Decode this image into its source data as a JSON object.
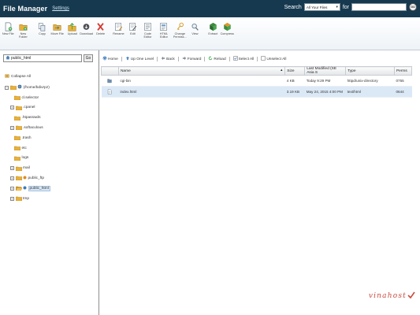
{
  "header": {
    "title": "File Manager",
    "settings_label": "Settings",
    "search_label": "Search",
    "search_scope": "All Your Files",
    "for_label": "for",
    "search_value": "",
    "go_label": "GO"
  },
  "toolbar": {
    "buttons": [
      {
        "label": "New File",
        "icon": "new-file-icon"
      },
      {
        "label": "New\nFolder",
        "icon": "new-folder-icon"
      },
      {
        "label": "Copy",
        "icon": "copy-icon"
      },
      {
        "label": "Move File",
        "icon": "move-file-icon"
      },
      {
        "label": "Upload",
        "icon": "upload-icon"
      },
      {
        "label": "Download",
        "icon": "download-icon"
      },
      {
        "label": "Delete",
        "icon": "delete-icon"
      },
      {
        "label": "Rename",
        "icon": "rename-icon"
      },
      {
        "label": "Edit",
        "icon": "edit-icon"
      },
      {
        "label": "Code\nEditor",
        "icon": "code-editor-icon"
      },
      {
        "label": "HTML\nEditor",
        "icon": "html-editor-icon"
      },
      {
        "label": "Change\nPermiss...",
        "icon": "permissions-icon"
      },
      {
        "label": "View",
        "icon": "view-icon"
      },
      {
        "label": "Extract",
        "icon": "extract-icon"
      },
      {
        "label": "Compress",
        "icon": "compress-icon"
      }
    ]
  },
  "tree": {
    "path_value": "public_html",
    "go_label": "Go",
    "collapse_all": "Collapse All",
    "root": "(/home/bdivrpz)",
    "items": [
      {
        "label": "cl.selector",
        "expandable": false
      },
      {
        "label": ".cpanel",
        "expandable": true
      },
      {
        "label": ".htpasswds",
        "expandable": false
      },
      {
        "label": ".softaculous",
        "expandable": true
      },
      {
        "label": ".trash",
        "expandable": false
      },
      {
        "label": "etc",
        "expandable": false
      },
      {
        "label": "logs",
        "expandable": false
      },
      {
        "label": "mail",
        "expandable": true
      },
      {
        "label": "public_ftp",
        "expandable": true
      },
      {
        "label": "public_html",
        "expandable": true,
        "selected": true
      },
      {
        "label": "tmp",
        "expandable": true
      }
    ]
  },
  "navbar": {
    "items": [
      {
        "label": "Home",
        "icon": "home-icon"
      },
      {
        "label": "Up One Level",
        "icon": "up-level-icon"
      },
      {
        "label": "Back",
        "icon": "back-icon"
      },
      {
        "label": "Forward",
        "icon": "forward-icon"
      },
      {
        "label": "Reload",
        "icon": "reload-icon"
      },
      {
        "label": "Select All",
        "icon": "select-all-icon"
      },
      {
        "label": "Unselect All",
        "icon": "unselect-all-icon"
      }
    ]
  },
  "files": {
    "columns": [
      "Name",
      "Size",
      "Last Modified (SE Asia S",
      "Type",
      "Perms"
    ],
    "rows": [
      {
        "name": "cgi-bin",
        "size": "4 KB",
        "modified": "Today 9:29 PM",
        "type": "httpd/unix-directory",
        "perms": "0755",
        "icon": "folder-icon"
      },
      {
        "name": "index.html",
        "size": "3.19 KB",
        "modified": "May 24, 2015 4:00 PM",
        "type": "text/html",
        "perms": "0644",
        "icon": "html-file-icon"
      }
    ]
  },
  "watermark": "vinahost",
  "colors": {
    "header_bg": "#16394f",
    "folder": "#e8b23a",
    "selection": "#d6e6f6",
    "watermark": "#c94a3f"
  }
}
